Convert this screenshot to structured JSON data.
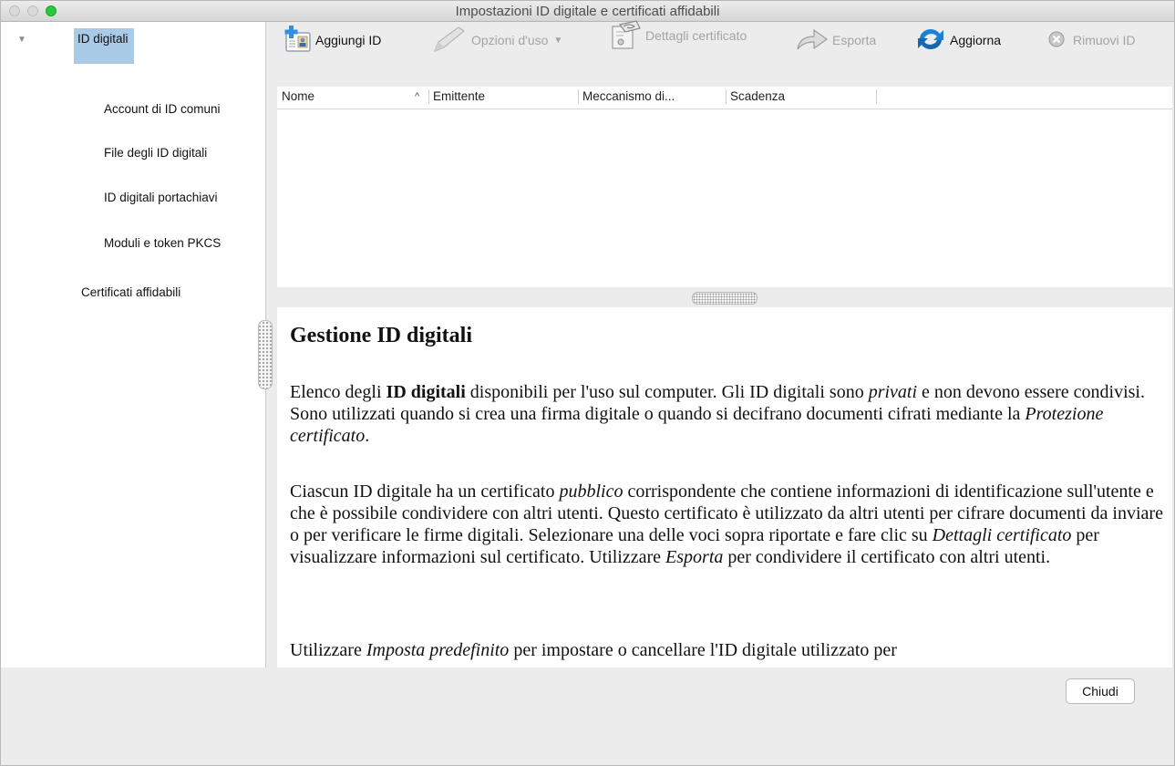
{
  "window": {
    "title": "Impostazioni ID digitale e certificati affidabili"
  },
  "sidebar": {
    "items": [
      {
        "label": "ID digitali"
      },
      {
        "label": "Account di ID comuni"
      },
      {
        "label": "File degli ID digitali"
      },
      {
        "label": "ID digitali portachiavi"
      },
      {
        "label": "Moduli e token PKCS"
      },
      {
        "label": "Certificati affidabili"
      }
    ]
  },
  "toolbar": {
    "add_id": "Aggiungi ID",
    "usage_options": "Opzioni d'uso",
    "certificate_details": "Dettagli certificato",
    "export": "Esporta",
    "refresh": "Aggiorna",
    "remove_id": "Rimuovi ID"
  },
  "table": {
    "columns": [
      "Nome",
      "Emittente",
      "Meccanismo di...",
      "Scadenza"
    ]
  },
  "doc": {
    "heading": "Gestione ID digitali",
    "p1": {
      "a": "Elenco degli ",
      "b": "ID digitali",
      "c": " disponibili per l'uso sul computer. Gli ID digitali sono ",
      "d": "privati",
      "e": " e non devono essere condivisi. Sono utilizzati quando si crea una firma digitale o quando si decifrano documenti cifrati mediante la ",
      "f": "Protezione certificato",
      "g": "."
    },
    "p2": {
      "a": "Ciascun ID digitale ha un certificato ",
      "b": "pubblico",
      "c": " corrispondente che contiene informazioni di identificazione sull'utente e che è possibile condividere con altri utenti. Questo certificato è utilizzato da altri utenti per cifrare documenti da inviare o per verificare le firme digitali. Selezionare una delle voci sopra riportate e fare clic su ",
      "d": "Dettagli certificato",
      "e": " per visualizzare informazioni sul certificato. Utilizzare ",
      "f": "Esporta",
      "g": " per condividere il certificato con altri utenti."
    },
    "p3": {
      "a": "Utilizzare ",
      "b": "Imposta predefinito",
      "c": " per impostare o cancellare l'ID digitale utilizzato per"
    }
  },
  "footer": {
    "close_button": "Chiudi"
  }
}
